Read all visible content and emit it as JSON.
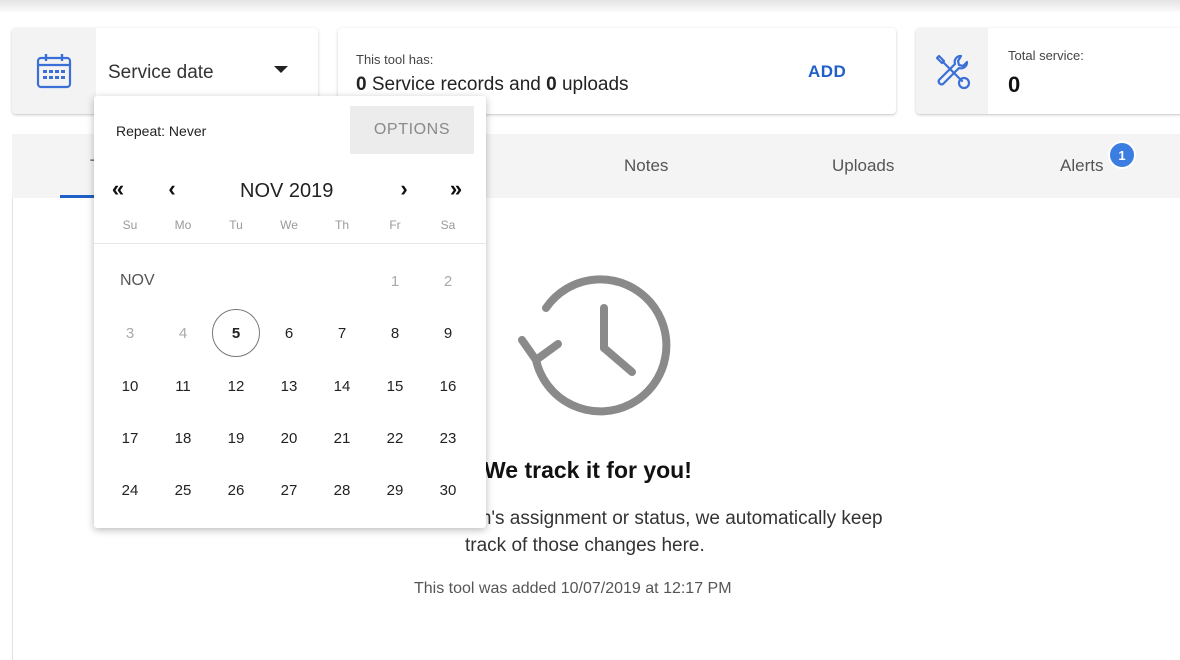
{
  "cards": {
    "date": {
      "label": "Service date"
    },
    "records": {
      "heading": "This tool has:",
      "records_count": "0",
      "records_text": " Service records and ",
      "uploads_count": "0",
      "uploads_text": " uploads",
      "add_label": "ADD"
    },
    "total": {
      "heading": "Total service:",
      "value": "0"
    }
  },
  "tabs": [
    {
      "label": "T"
    },
    {
      "label": "Notes"
    },
    {
      "label": "Uploads"
    },
    {
      "label": "Alerts"
    }
  ],
  "alerts_badge": "1",
  "empty_state": {
    "heading": "We track it for you!",
    "line1": "em's assignment or status, we automatically keep",
    "line2": "track of those changes here.",
    "added_note": "This tool was added 10/07/2019 at 12:17 PM"
  },
  "picker": {
    "repeat": "Repeat: Never",
    "options": "OPTIONS",
    "nav": {
      "prev_year": "«",
      "prev_month": "‹",
      "next_month": "›",
      "next_year": "»"
    },
    "month_title": "NOV 2019",
    "weekdays": [
      "Su",
      "Mo",
      "Tu",
      "We",
      "Th",
      "Fr",
      "Sa"
    ],
    "month_label": "NOV",
    "days": [
      "1",
      "2",
      "3",
      "4",
      "5",
      "6",
      "7",
      "8",
      "9",
      "10",
      "11",
      "12",
      "13",
      "14",
      "15",
      "16",
      "17",
      "18",
      "19",
      "20",
      "21",
      "22",
      "23",
      "24",
      "25",
      "26",
      "27",
      "28",
      "29",
      "30"
    ],
    "selected_day": "5"
  },
  "icons": [
    "calendar-icon",
    "tools-icon",
    "history-icon"
  ],
  "colors": {
    "accent": "#1f5fc8",
    "badge": "#3b7de0",
    "icon_gray": "#8a8a8a"
  }
}
